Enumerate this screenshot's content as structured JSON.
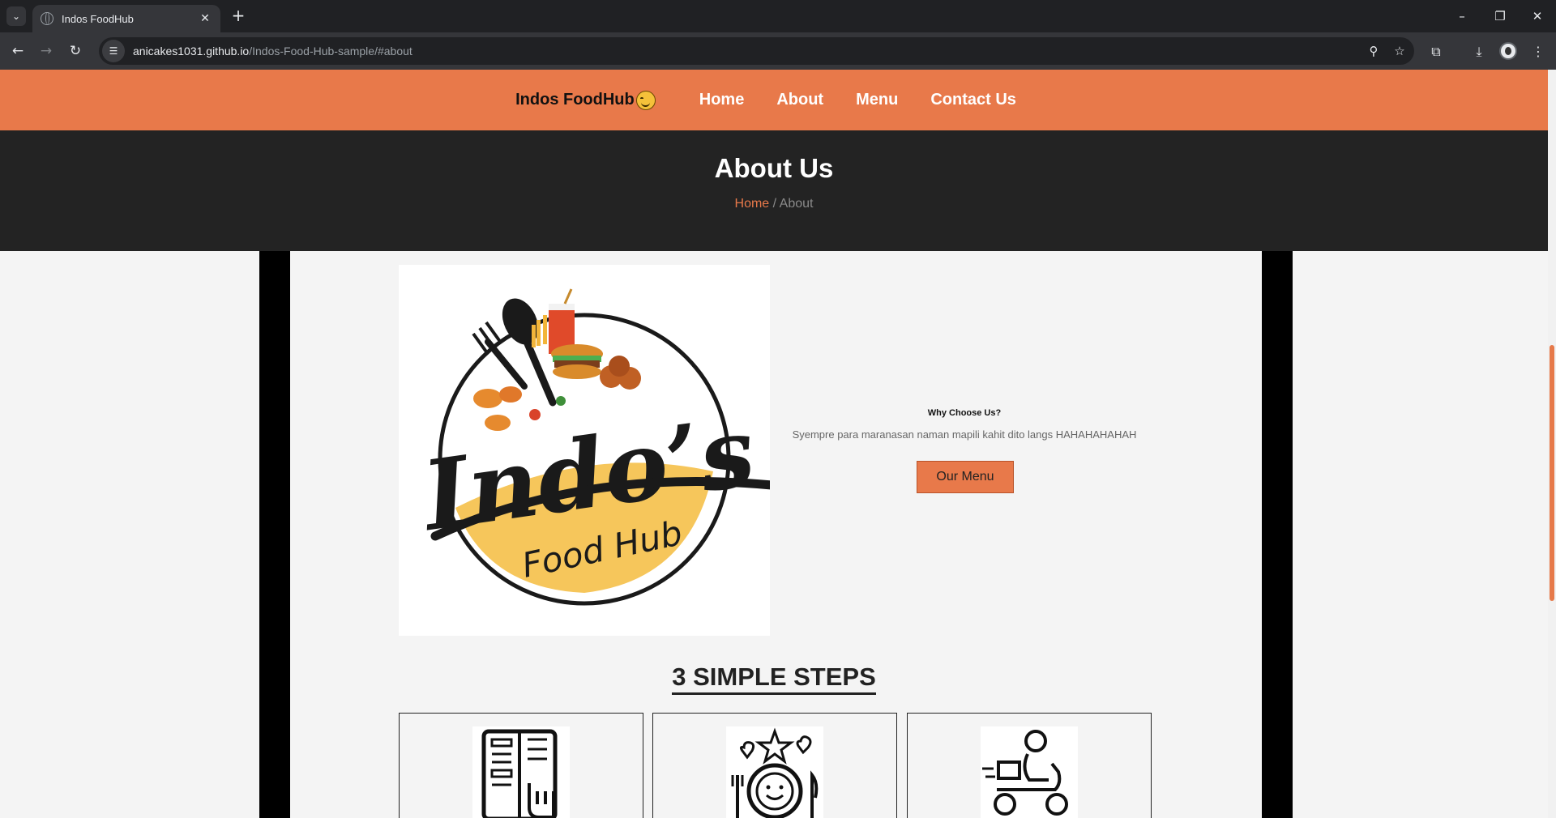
{
  "browser": {
    "tab_title": "Indos FoodHub",
    "tab_close": "✕",
    "new_tab": "+",
    "url_host": "anicakes1031.github.io",
    "url_path": "/Indos-Food-Hub-sample/#about"
  },
  "nav": {
    "brand": "Indos FoodHub",
    "links": [
      "Home",
      "About",
      "Menu",
      "Contact Us"
    ]
  },
  "hero": {
    "title": "About Us",
    "breadcrumb_home": "Home",
    "breadcrumb_separator": " / ",
    "breadcrumb_current": "About"
  },
  "logo": {
    "main_text": "Indo’s",
    "sub_text": "Food Hub"
  },
  "about": {
    "heading": "Why Choose Us?",
    "text": "Syempre para maranasan naman mapili kahit dito langs HAHAHAHAHAH",
    "button": "Our Menu"
  },
  "steps": {
    "title": "3 SIMPLE STEPS",
    "icons": [
      "menu-hand-icon",
      "dining-plate-icon",
      "delivery-scooter-icon"
    ]
  },
  "colors": {
    "accent": "#e8794a",
    "hero_bg": "#232323",
    "page_bg": "#f4f4f4"
  }
}
